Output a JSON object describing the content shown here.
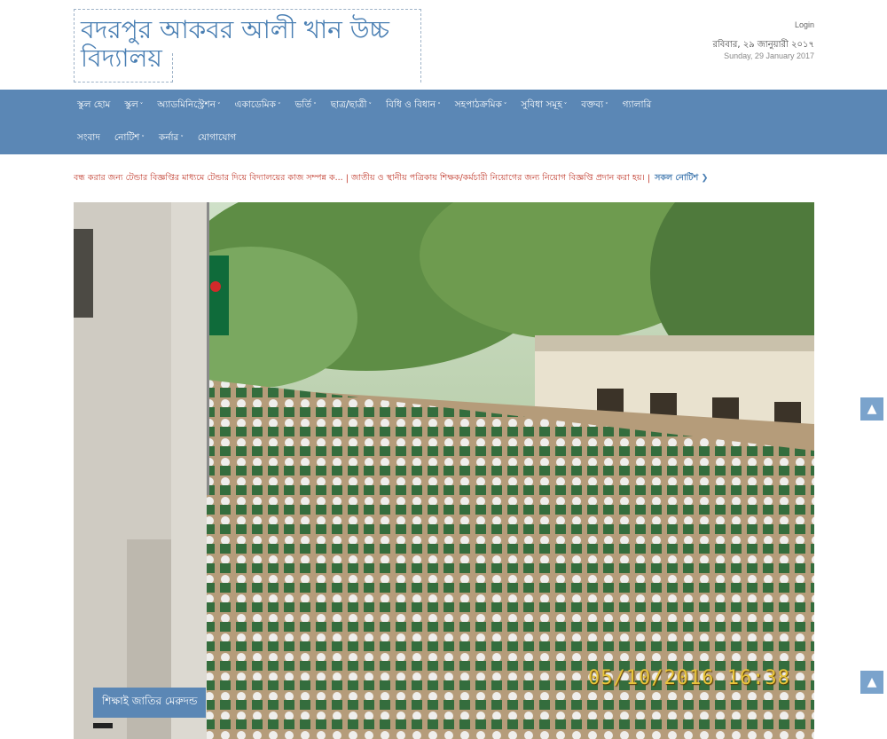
{
  "header": {
    "school_name": "বদরপুর আকবর আলী খান উচ্চ বিদ্যালয়",
    "login_label": "Login",
    "date_bn": "রবিবার, ২৯ জানুয়ারী ২০১৭",
    "date_en": "Sunday, 29 January 2017"
  },
  "nav": {
    "row1": [
      {
        "label": "স্কুল হোম",
        "dropdown": false
      },
      {
        "label": "স্কুল",
        "dropdown": true
      },
      {
        "label": "অ্যাডমিনিস্ট্রেশন",
        "dropdown": true
      },
      {
        "label": "একাডেমিক",
        "dropdown": true
      },
      {
        "label": "ভর্তি",
        "dropdown": true
      },
      {
        "label": "ছাত্র/ছাত্রী",
        "dropdown": true
      },
      {
        "label": "বিধি ও বিধান",
        "dropdown": true
      },
      {
        "label": "সহপাঠক্রমিক",
        "dropdown": true
      },
      {
        "label": "সুবিধা সমূহ",
        "dropdown": true
      },
      {
        "label": "বক্তব্য",
        "dropdown": true
      },
      {
        "label": "গ্যালারি",
        "dropdown": false
      }
    ],
    "row2": [
      {
        "label": "সংবাদ",
        "dropdown": false
      },
      {
        "label": "নোটিশ",
        "dropdown": true
      },
      {
        "label": "কর্নার",
        "dropdown": true
      },
      {
        "label": "যোগাযোগ",
        "dropdown": false
      }
    ]
  },
  "ticker": {
    "item1": "বন্ধ করার জন্য টেন্ডার বিজ্ঞপ্তির মাধ্যমে টেন্ডার দিয়ে বিদ্যালয়ের কাজ সম্পন্ন ক...",
    "item2": "জাতীয় ও স্থানীয় পত্রিকায় শিক্ষক/কর্মচারী নিয়োগের জন্য নিয়োগ বিজ্ঞপ্তি প্রদান করা হয়।",
    "separator": "|",
    "all_notices": "সকল নোটিশ",
    "arrow_icon": "chevron-right-icon"
  },
  "slider": {
    "caption": "শিক্ষাই জাতির মেরুদন্ড",
    "timestamp": "05/10/2016  16:38"
  },
  "colors": {
    "brand_blue": "#5b87b5",
    "title_blue": "#4a7fb3",
    "ticker_red": "#c0392b"
  }
}
